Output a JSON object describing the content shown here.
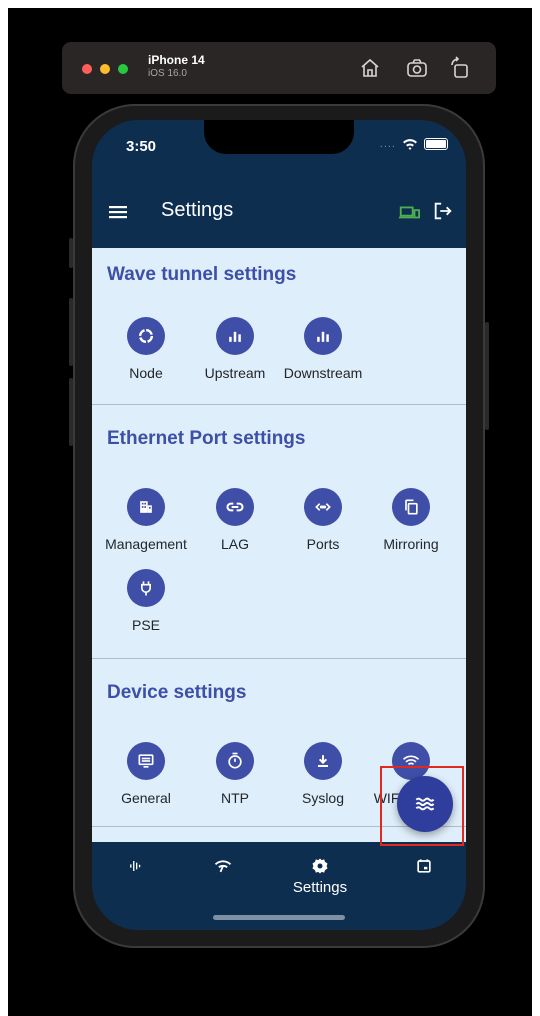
{
  "simulator": {
    "device_name": "iPhone 14",
    "os_version": "iOS 16.0",
    "buttons": [
      "home-icon",
      "screenshot-icon",
      "rotate-icon"
    ]
  },
  "status_bar": {
    "time": "3:50",
    "signal": "....",
    "icons": [
      "wifi-icon",
      "battery-icon"
    ]
  },
  "app_bar": {
    "title": "Settings",
    "icons": [
      "menu-icon",
      "devices-icon",
      "logout-icon"
    ],
    "devices_icon_color": "#4caf50"
  },
  "sections": [
    {
      "title": "Wave tunnel settings",
      "items": [
        {
          "label": "Node",
          "icon": "node-icon"
        },
        {
          "label": "Upstream",
          "icon": "bar-chart-icon"
        },
        {
          "label": "Downstream",
          "icon": "bar-chart-icon"
        }
      ]
    },
    {
      "title": "Ethernet Port settings",
      "items": [
        {
          "label": "Management",
          "icon": "building-icon"
        },
        {
          "label": "LAG",
          "icon": "link-icon"
        },
        {
          "label": "Ports",
          "icon": "code-arrows-icon"
        },
        {
          "label": "Mirroring",
          "icon": "copy-icon"
        },
        {
          "label": "PSE",
          "icon": "power-plug-icon"
        }
      ]
    },
    {
      "title": "Device settings",
      "items": [
        {
          "label": "General",
          "icon": "monitor-icon"
        },
        {
          "label": "NTP",
          "icon": "timer-icon"
        },
        {
          "label": "Syslog",
          "icon": "download-icon"
        },
        {
          "label": "WIFI",
          "label_tail": "s",
          "icon": "wifi-icon"
        }
      ]
    }
  ],
  "bottom_nav": {
    "items": [
      {
        "label": "",
        "icon": "activity-icon"
      },
      {
        "label": "",
        "icon": "wifi-signal-icon"
      },
      {
        "label": "Settings",
        "icon": "gear-icon",
        "active": true
      },
      {
        "label": "",
        "icon": "calendar-icon"
      }
    ]
  },
  "fab": {
    "icon": "waves-icon"
  },
  "colors": {
    "app_bar": "#0e2e4f",
    "content_bg": "#deeefa",
    "accent": "#3f4fa8",
    "highlight_border": "#e0281f"
  }
}
